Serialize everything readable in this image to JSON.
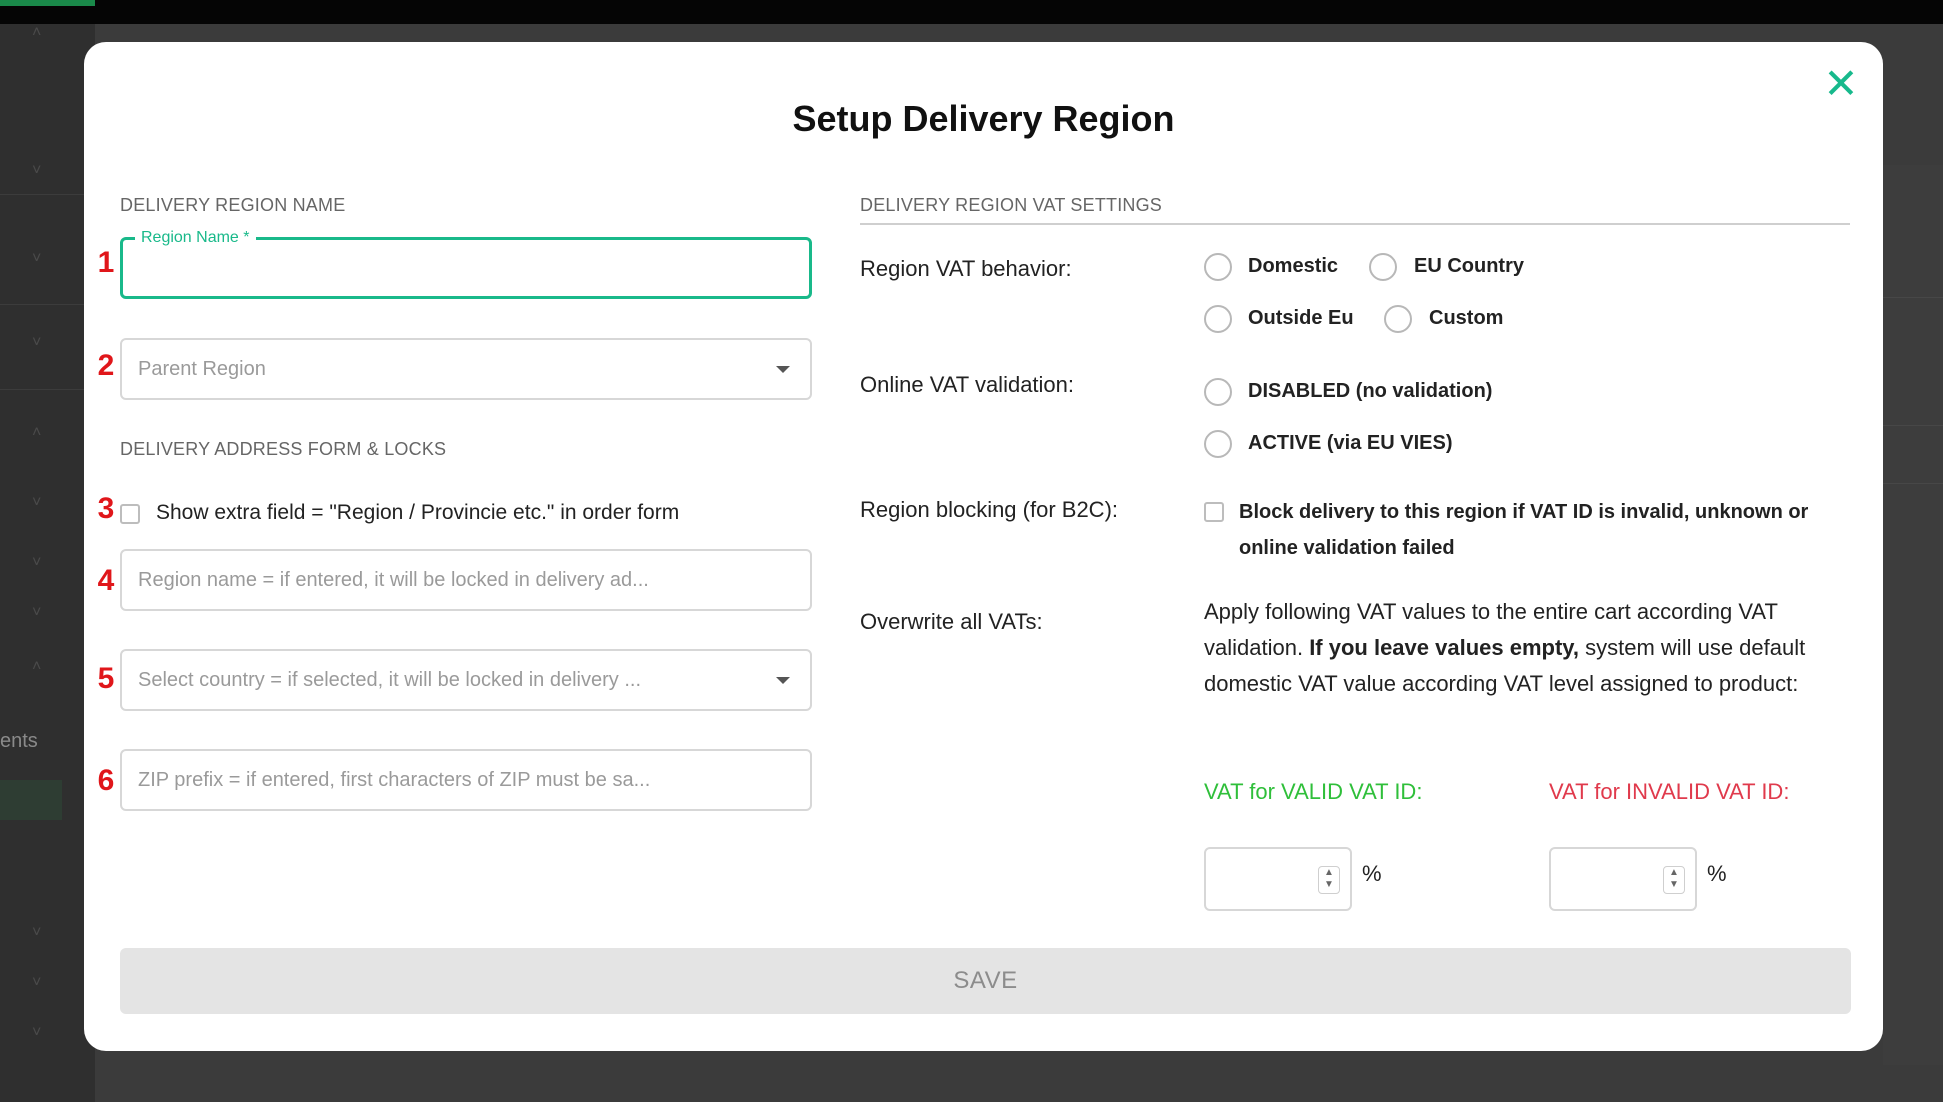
{
  "modal": {
    "title": "Setup Delivery Region",
    "close_icon": "close-icon"
  },
  "left": {
    "section_name": "DELIVERY REGION NAME",
    "region_name": {
      "label": "Region Name *",
      "value": ""
    },
    "parent_region": {
      "placeholder": "Parent Region"
    },
    "section_form": "DELIVERY ADDRESS FORM & LOCKS",
    "extra_field_label": "Show extra field = \"Region / Provincie etc.\" in order form",
    "lock_region_name": {
      "placeholder": "Region name = if entered, it will be locked in delivery ad..."
    },
    "lock_country": {
      "placeholder": "Select country = if selected, it will be locked in delivery ..."
    },
    "zip_prefix": {
      "placeholder": "ZIP prefix = if entered, first characters of ZIP must be sa..."
    },
    "steps": [
      "1",
      "2",
      "3",
      "4",
      "5",
      "6"
    ]
  },
  "right": {
    "section_vat": "DELIVERY REGION VAT SETTINGS",
    "vat_behavior": {
      "label": "Region VAT behavior:",
      "options": [
        "Domestic",
        "EU Country",
        "Outside Eu",
        "Custom"
      ]
    },
    "online_validation": {
      "label": "Online VAT validation:",
      "options": [
        "DISABLED (no validation)",
        "ACTIVE (via EU VIES)"
      ]
    },
    "region_blocking": {
      "label": "Region blocking (for B2C):",
      "checkbox_line1": "Block delivery to this region if VAT ID is invalid, unknown or",
      "checkbox_line2": "online validation failed"
    },
    "overwrite": {
      "label": "Overwrite all VATs:",
      "text_1": "Apply following VAT values to the entire cart according VAT validation. ",
      "text_bold": "If you leave values empty,",
      "text_2": " system will use default domestic VAT value according VAT level assigned to product:",
      "valid_label": "VAT for VALID VAT ID:",
      "invalid_label": "VAT for INVALID VAT ID:",
      "valid_value": "",
      "invalid_value": "",
      "percent": "%"
    }
  },
  "save_label": "SAVE",
  "background": {
    "sidebar_text": "ents"
  },
  "colors": {
    "accent": "#19b98a",
    "valid": "#2fbf3a",
    "invalid": "#e03a4c",
    "step_number": "#e0161a"
  }
}
